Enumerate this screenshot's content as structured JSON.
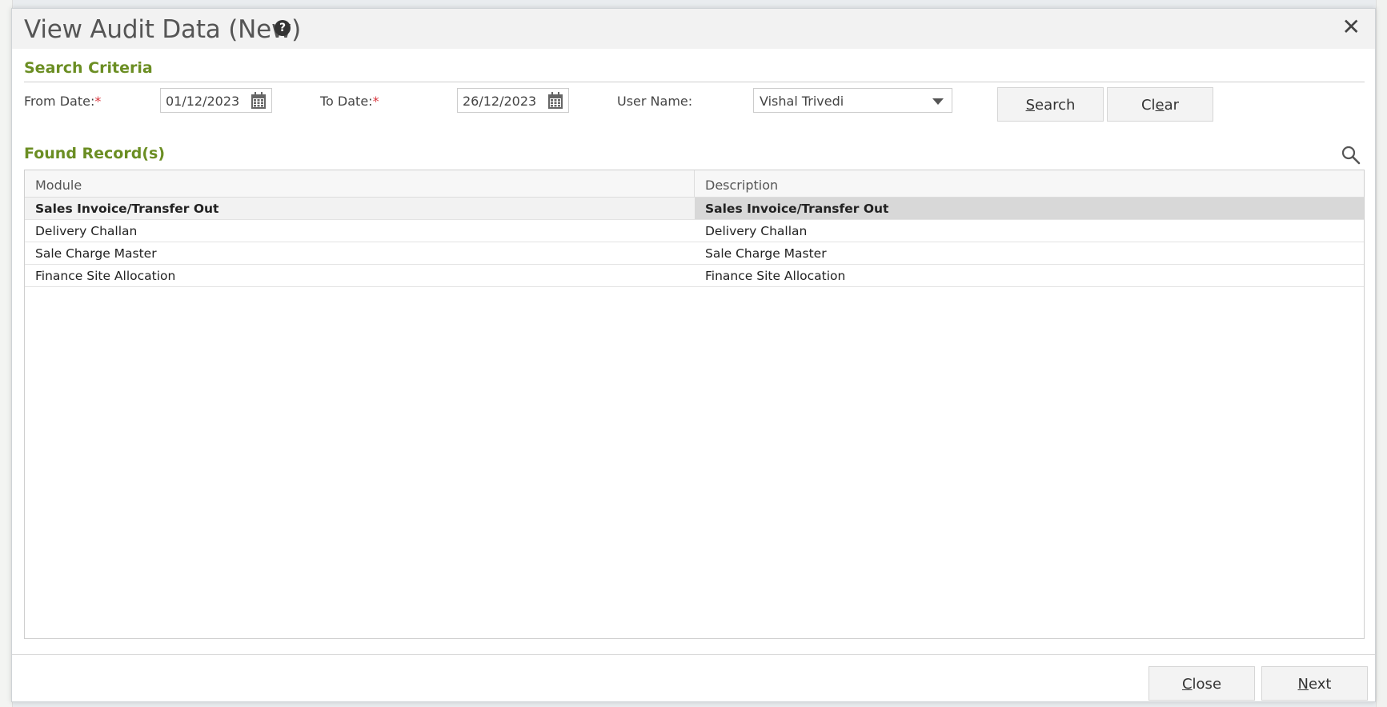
{
  "dialog": {
    "title": "View Audit Data (New)",
    "help_icon": "question-circle-icon",
    "close_icon": "close-x-icon"
  },
  "search_criteria": {
    "heading": "Search Criteria",
    "from_date_label": "From Date:",
    "from_date_value": "01/12/2023",
    "to_date_label": "To Date:",
    "to_date_value": "26/12/2023",
    "required_mark": "*",
    "user_name_label": "User Name:",
    "user_name_value": "Vishal Trivedi",
    "search_label_prefix": "S",
    "search_label_rest": "earch",
    "clear_label_prefix": "Cl",
    "clear_label_u": "e",
    "clear_label_rest": "ar"
  },
  "found_records": {
    "heading": "Found Record(s)",
    "columns": [
      "Module",
      "Description"
    ],
    "rows": [
      {
        "module": "Sales Invoice/Transfer Out",
        "description": "Sales Invoice/Transfer Out"
      },
      {
        "module": "Delivery Challan",
        "description": "Delivery Challan"
      },
      {
        "module": "Sale Charge Master",
        "description": "Sale Charge Master"
      },
      {
        "module": "Finance Site Allocation",
        "description": "Finance Site Allocation"
      }
    ]
  },
  "footer": {
    "close_prefix": "C",
    "close_rest": "lose",
    "next_prefix": "N",
    "next_rest": "ext"
  },
  "colors": {
    "section_heading": "#6b8e23",
    "required": "#d9363e"
  }
}
